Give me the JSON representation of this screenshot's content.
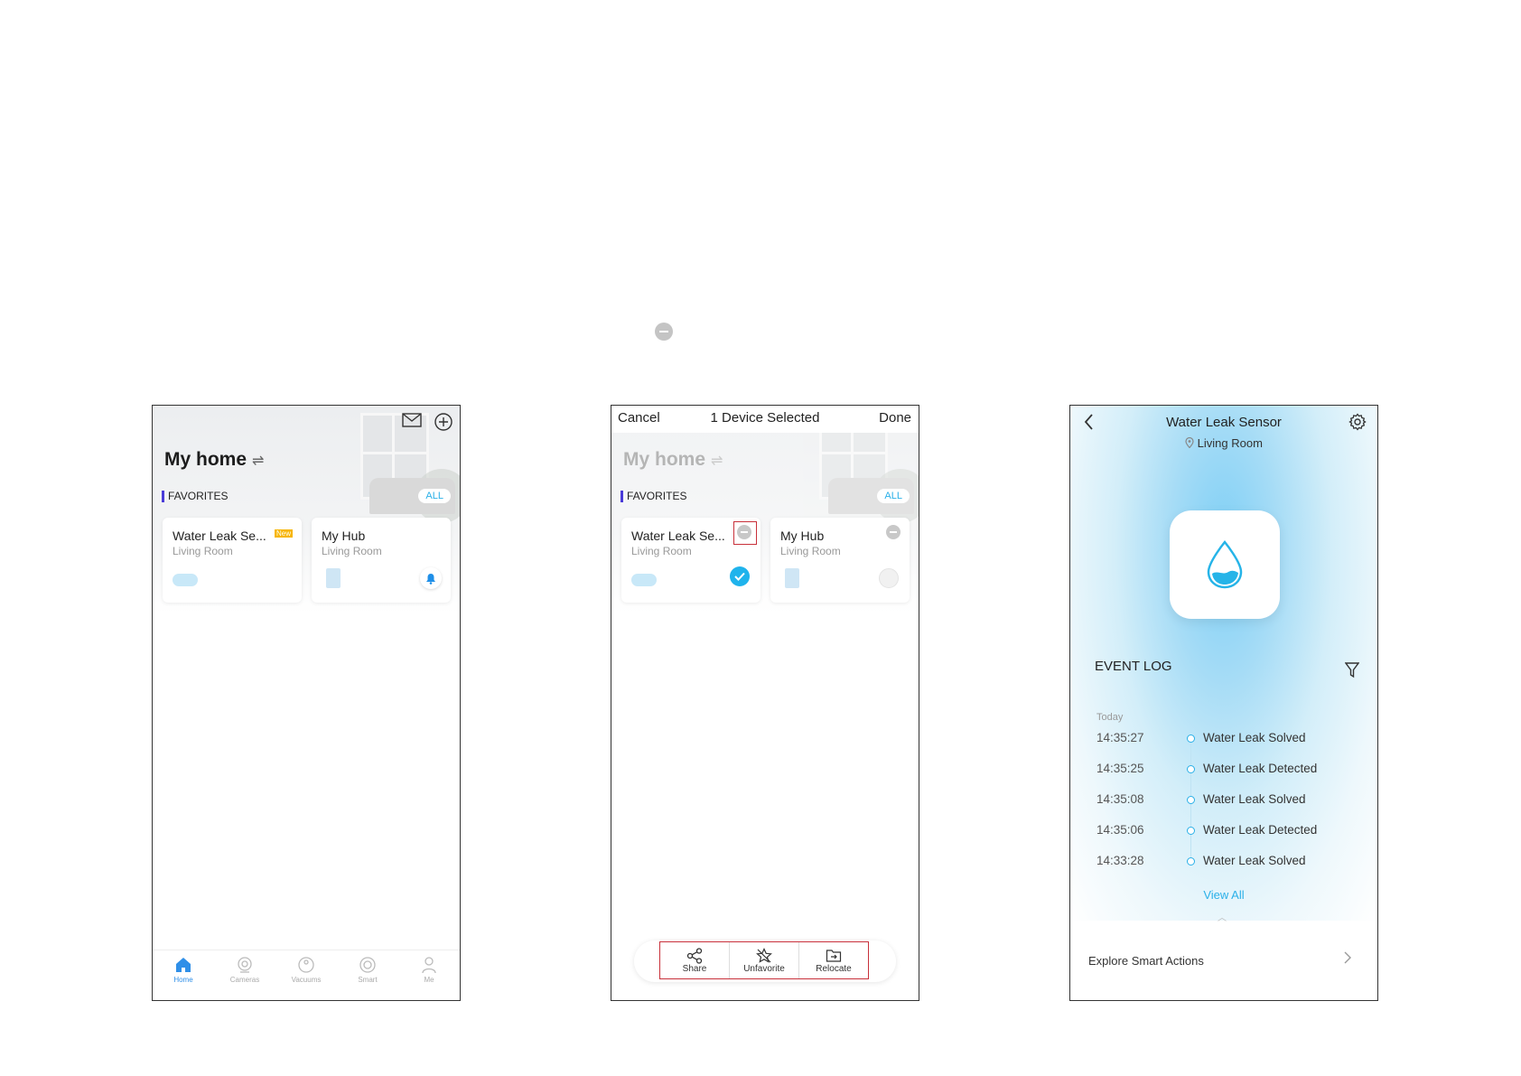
{
  "floating_icon": "minus-circle-icon",
  "screen1": {
    "title": "My home",
    "switch_glyph": "⇌",
    "favorites_label": "FAVORITES",
    "all_label": "ALL",
    "devices": [
      {
        "name": "Water Leak Se...",
        "room": "Living Room",
        "badge": "New"
      },
      {
        "name": "My Hub",
        "room": "Living Room"
      }
    ],
    "tabs": [
      "Home",
      "Cameras",
      "Vacuums",
      "Smart",
      "Me"
    ]
  },
  "screen2": {
    "cancel": "Cancel",
    "selected": "1 Device Selected",
    "done": "Done",
    "title": "My home",
    "switch_glyph": "⇌",
    "favorites_label": "FAVORITES",
    "all_label": "ALL",
    "devices": [
      {
        "name": "Water Leak Se...",
        "room": "Living Room"
      },
      {
        "name": "My Hub",
        "room": "Living Room"
      }
    ],
    "actions": [
      "Share",
      "Unfavorite",
      "Relocate"
    ]
  },
  "screen3": {
    "title": "Water Leak Sensor",
    "room": "Living Room",
    "event_log": "EVENT LOG",
    "today": "Today",
    "events": [
      {
        "time": "14:35:27",
        "event": "Water Leak Solved"
      },
      {
        "time": "14:35:25",
        "event": "Water Leak Detected"
      },
      {
        "time": "14:35:08",
        "event": "Water Leak Solved"
      },
      {
        "time": "14:35:06",
        "event": "Water Leak Detected"
      },
      {
        "time": "14:33:28",
        "event": "Water Leak Solved"
      }
    ],
    "view_all": "View All",
    "explore": "Explore Smart Actions"
  },
  "colors": {
    "accent_blue": "#2ab0e8",
    "highlight_red": "#c8303a",
    "tab_active": "#2f8fe8",
    "favorites_bar": "#4a3bd8"
  }
}
